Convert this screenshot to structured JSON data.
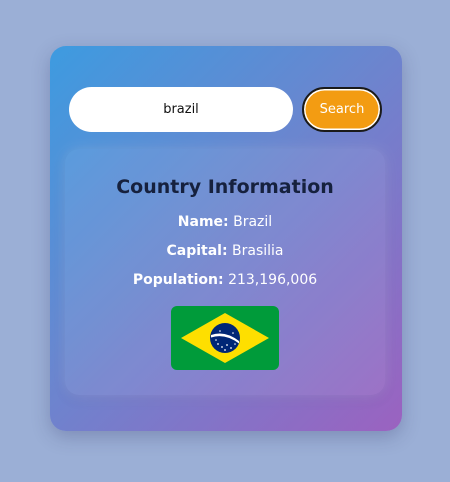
{
  "search": {
    "value": "brazil",
    "button_label": "Search"
  },
  "info": {
    "title": "Country Information",
    "name_label": "Name:",
    "name_value": "Brazil",
    "capital_label": "Capital:",
    "capital_value": "Brasilia",
    "population_label": "Population:",
    "population_value": "213,196,006"
  },
  "flag": {
    "icon": "brazil-flag",
    "colors": {
      "green": "#009b3a",
      "yellow": "#fedf00",
      "blue": "#002776"
    }
  },
  "colors": {
    "page_background": "#9bafd6",
    "button": "#f39c12",
    "title": "#16213e"
  }
}
